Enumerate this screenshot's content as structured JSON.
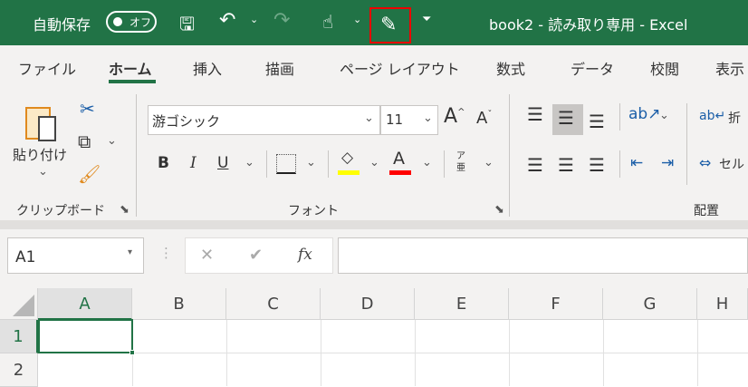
{
  "titlebar": {
    "autosave_label": "自動保存",
    "autosave_state": "オフ",
    "title": "book2 - 読み取り専用 - Excel"
  },
  "tabs": [
    {
      "label": "ファイル"
    },
    {
      "label": "ホーム"
    },
    {
      "label": "挿入"
    },
    {
      "label": "描画"
    },
    {
      "label": "ページ レイアウト"
    },
    {
      "label": "数式"
    },
    {
      "label": "データ"
    },
    {
      "label": "校閲"
    },
    {
      "label": "表示"
    }
  ],
  "ribbon": {
    "paste_label": "貼り付け",
    "clipboard_group": "クリップボード",
    "font_name": "游ゴシック",
    "font_size": "11",
    "font_group": "フォント",
    "bold": "B",
    "italic": "I",
    "underline": "U",
    "font_color_letter": "A",
    "furigana": "ア亜",
    "wrap_label": "折",
    "merge_label": "セル",
    "alignment_group": "配置",
    "fill_color": "#ffff00",
    "font_color": "#ff0000"
  },
  "formula": {
    "name_box": "A1",
    "fx": "fx",
    "value": ""
  },
  "sheet": {
    "columns": [
      "A",
      "B",
      "C",
      "D",
      "E",
      "F",
      "G",
      "H"
    ],
    "rows": [
      "1",
      "2"
    ]
  }
}
